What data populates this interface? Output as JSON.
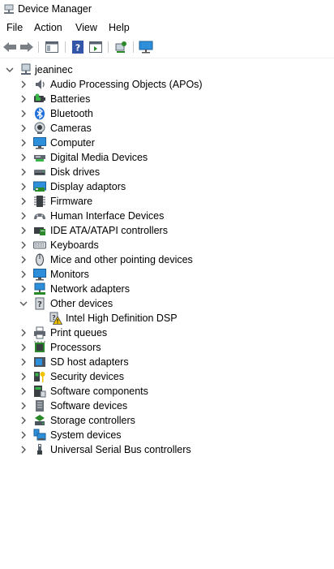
{
  "window": {
    "title": "Device Manager"
  },
  "menu": [
    "File",
    "Action",
    "View",
    "Help"
  ],
  "tree": {
    "root": "jeaninec",
    "categories": [
      {
        "label": "Audio Processing Objects (APOs)",
        "icon": "speaker-icon"
      },
      {
        "label": "Batteries",
        "icon": "battery-icon"
      },
      {
        "label": "Bluetooth",
        "icon": "bluetooth-icon"
      },
      {
        "label": "Cameras",
        "icon": "camera-icon"
      },
      {
        "label": "Computer",
        "icon": "computer-icon"
      },
      {
        "label": "Digital Media Devices",
        "icon": "media-device-icon"
      },
      {
        "label": "Disk drives",
        "icon": "disk-drive-icon"
      },
      {
        "label": "Display adaptors",
        "icon": "display-adapter-icon"
      },
      {
        "label": "Firmware",
        "icon": "firmware-chip-icon"
      },
      {
        "label": "Human Interface Devices",
        "icon": "hid-icon"
      },
      {
        "label": "IDE ATA/ATAPI controllers",
        "icon": "ide-controller-icon"
      },
      {
        "label": "Keyboards",
        "icon": "keyboard-icon"
      },
      {
        "label": "Mice and other pointing devices",
        "icon": "mouse-icon"
      },
      {
        "label": "Monitors",
        "icon": "monitor-icon"
      },
      {
        "label": "Network adapters",
        "icon": "network-adapter-icon"
      },
      {
        "label": "Other devices",
        "icon": "unknown-device-icon",
        "expanded": true,
        "children": [
          {
            "label": "Intel High Definition DSP",
            "icon": "warning-device-icon"
          }
        ]
      },
      {
        "label": "Print queues",
        "icon": "printer-icon"
      },
      {
        "label": "Processors",
        "icon": "processor-icon"
      },
      {
        "label": "SD host adapters",
        "icon": "sd-host-icon"
      },
      {
        "label": "Security devices",
        "icon": "security-key-icon"
      },
      {
        "label": "Software components",
        "icon": "software-component-icon"
      },
      {
        "label": "Software devices",
        "icon": "software-device-icon"
      },
      {
        "label": "Storage controllers",
        "icon": "storage-controller-icon"
      },
      {
        "label": "System devices",
        "icon": "system-devices-icon"
      },
      {
        "label": "Universal Serial Bus controllers",
        "icon": "usb-icon"
      }
    ]
  },
  "colors": {
    "accent": "#1e6fd9",
    "warning": "#f2c200",
    "chevron": "#555555"
  }
}
